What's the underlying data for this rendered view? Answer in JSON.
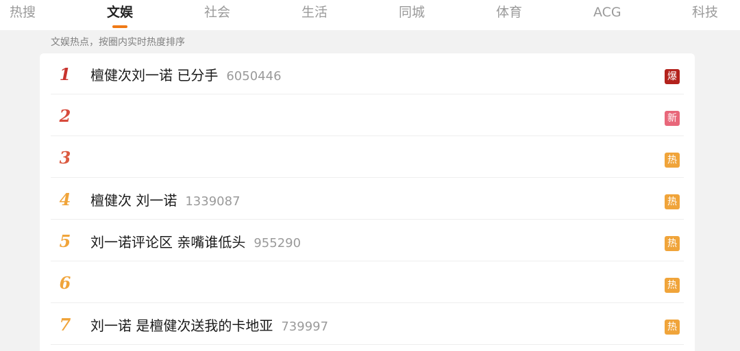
{
  "tabs": [
    {
      "label": "热搜"
    },
    {
      "label": "文娱"
    },
    {
      "label": "社会"
    },
    {
      "label": "生活"
    },
    {
      "label": "同城"
    },
    {
      "label": "体育"
    },
    {
      "label": "ACG"
    },
    {
      "label": "科技"
    }
  ],
  "active_tab": "文娱",
  "subtitle": "文娱热点，按圈内实时热度排序",
  "items": [
    {
      "rank": "1",
      "title": "檀健次刘一诺 已分手",
      "count": "6050446",
      "badge": "爆",
      "rank_color": "#c8332e",
      "badge_color": "#b3221c"
    },
    {
      "rank": "2",
      "title": "",
      "count": "",
      "badge": "新",
      "rank_color": "#d74a3c",
      "badge_color": "#e8677a"
    },
    {
      "rank": "3",
      "title": "",
      "count": "",
      "badge": "热",
      "rank_color": "#db5a40",
      "badge_color": "#f0a43a"
    },
    {
      "rank": "4",
      "title": "檀健次 刘一诺",
      "count": "1339087",
      "badge": "热",
      "rank_color": "#f0a43a",
      "badge_color": "#f0a43a"
    },
    {
      "rank": "5",
      "title": "刘一诺评论区 亲嘴谁低头",
      "count": "955290",
      "badge": "热",
      "rank_color": "#f0a43a",
      "badge_color": "#f0a43a"
    },
    {
      "rank": "6",
      "title": "",
      "count": "",
      "badge": "热",
      "rank_color": "#f0a43a",
      "badge_color": "#f0a43a"
    },
    {
      "rank": "7",
      "title": "刘一诺 是檀健次送我的卡地亚",
      "count": "739997",
      "badge": "热",
      "rank_color": "#f0a43a",
      "badge_color": "#f0a43a"
    }
  ]
}
